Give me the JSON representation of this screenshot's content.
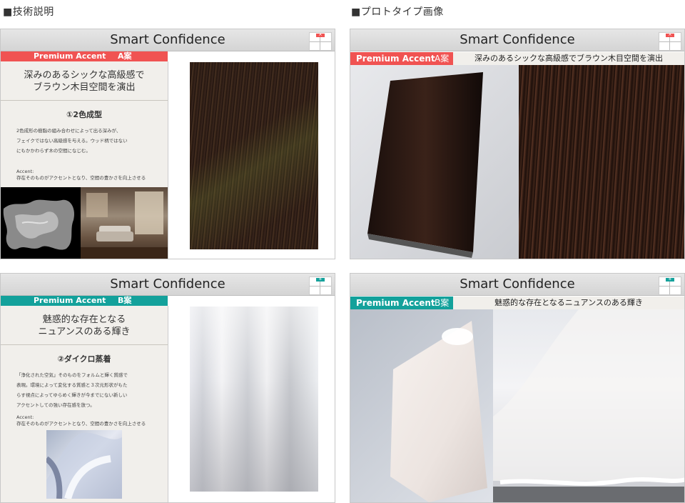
{
  "sections": {
    "left": "■技術説明",
    "right": "■プロトタイプ画像"
  },
  "card_title": "Smart Confidence",
  "accent_label": "Premium Accent",
  "colors": {
    "red": "#f05352",
    "teal": "#13a19b"
  },
  "option_a": {
    "suffix": "A案",
    "headline": [
      "深みのあるシックな高級感で",
      "ブラウン木目空間を演出"
    ],
    "headline_single": "深みのあるシックな高級感でブラウン木目空間を演出",
    "feature": "①2色成型",
    "description": [
      "2色成形の樹脂の組み合わせによって出る深みが、",
      "フェイクではない高級感を与える。ウッド柄ではない",
      "にもかかわらず木の空間になじむ。"
    ],
    "accent_title": "Accent:",
    "accent_text": "存在そのものがアクセントとなり、空間の豊かさを向上させる"
  },
  "option_b": {
    "suffix": "B案",
    "headline": [
      "魅惑的な存在となる",
      "ニュアンスのある輝き"
    ],
    "headline_single": "魅惑的な存在となるニュアンスのある輝き",
    "feature": "②ダイクロ蒸着",
    "description": [
      "「浄化された空気」そのものをフォルムと輝く質感で",
      "表現。環境によって変化する質感と３次元形状がもた",
      "らす視点によってゆらめく輝きが今までにない新しい",
      "アクセントしての強い存在感を放つ。"
    ],
    "accent_title": "Accent:",
    "accent_text": "存在そのものがアクセントとなり、空間の豊かさを向上させる"
  },
  "mini_tab_a": "A",
  "mini_tab_b": "B"
}
